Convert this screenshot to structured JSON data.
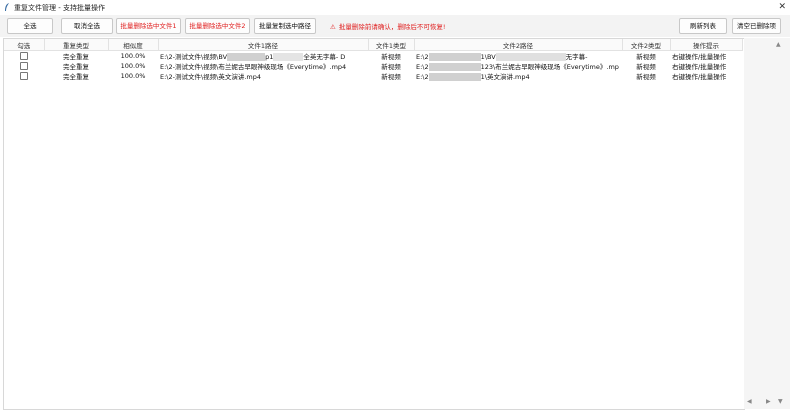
{
  "window": {
    "title": "重复文件管理 - 支持批量操作",
    "close_symbol": "✕"
  },
  "toolbar": {
    "select_all": "全选",
    "deselect_all": "取消全选",
    "batch_delete_file1": "批量删除选中文件1",
    "batch_delete_file2": "批量删除选中文件2",
    "batch_copy_paths": "批量复制选中路径",
    "warning": "批量删除前请确认，删除后不可恢复!",
    "refresh_list": "刷新列表",
    "clear_deleted": "清空已删除项",
    "accent_red": "#e02020"
  },
  "table": {
    "columns": [
      "勾选",
      "重复类型",
      "相似度",
      "文件1路径",
      "文件1类型",
      "文件2路径",
      "文件2类型",
      "操作提示"
    ],
    "rows": [
      {
        "type": "完全重复",
        "similarity": "100.0%",
        "file1_a": "E:\\2-测试文件\\视频\\BV",
        "file1_b": "p1",
        "file1_c": "全英无字幕- D",
        "file1_type": "新视频",
        "file2_a": "E:\\2",
        "file2_b": "1\\BV",
        "file2_c": "无字幕-",
        "file2_type": "新视频",
        "hint": "右键操作/批量操作"
      },
      {
        "type": "完全重复",
        "similarity": "100.0%",
        "file1_a": "E:\\2-测试文件\\视频\\布兰妮古早眼神级现场《Everytime》.mp4",
        "file1_b": "",
        "file1_c": "",
        "file1_type": "新视频",
        "file2_a": "E:\\2",
        "file2_b": "123\\布兰妮古早眼神级现场《Everytime》.mp",
        "file2_c": "",
        "file2_type": "新视频",
        "hint": "右键操作/批量操作"
      },
      {
        "type": "完全重复",
        "similarity": "100.0%",
        "file1_a": "E:\\2-测试文件\\视频\\英文演讲.mp4",
        "file1_b": "",
        "file1_c": "",
        "file1_type": "新视频",
        "file2_a": "E:\\2",
        "file2_b": "1\\英文演讲.mp4",
        "file2_c": "",
        "file2_type": "新视频",
        "hint": "右键操作/批量操作"
      }
    ]
  },
  "scrollbar": {
    "up": "▲",
    "left": "◀",
    "right": "▶",
    "down": "▼"
  }
}
